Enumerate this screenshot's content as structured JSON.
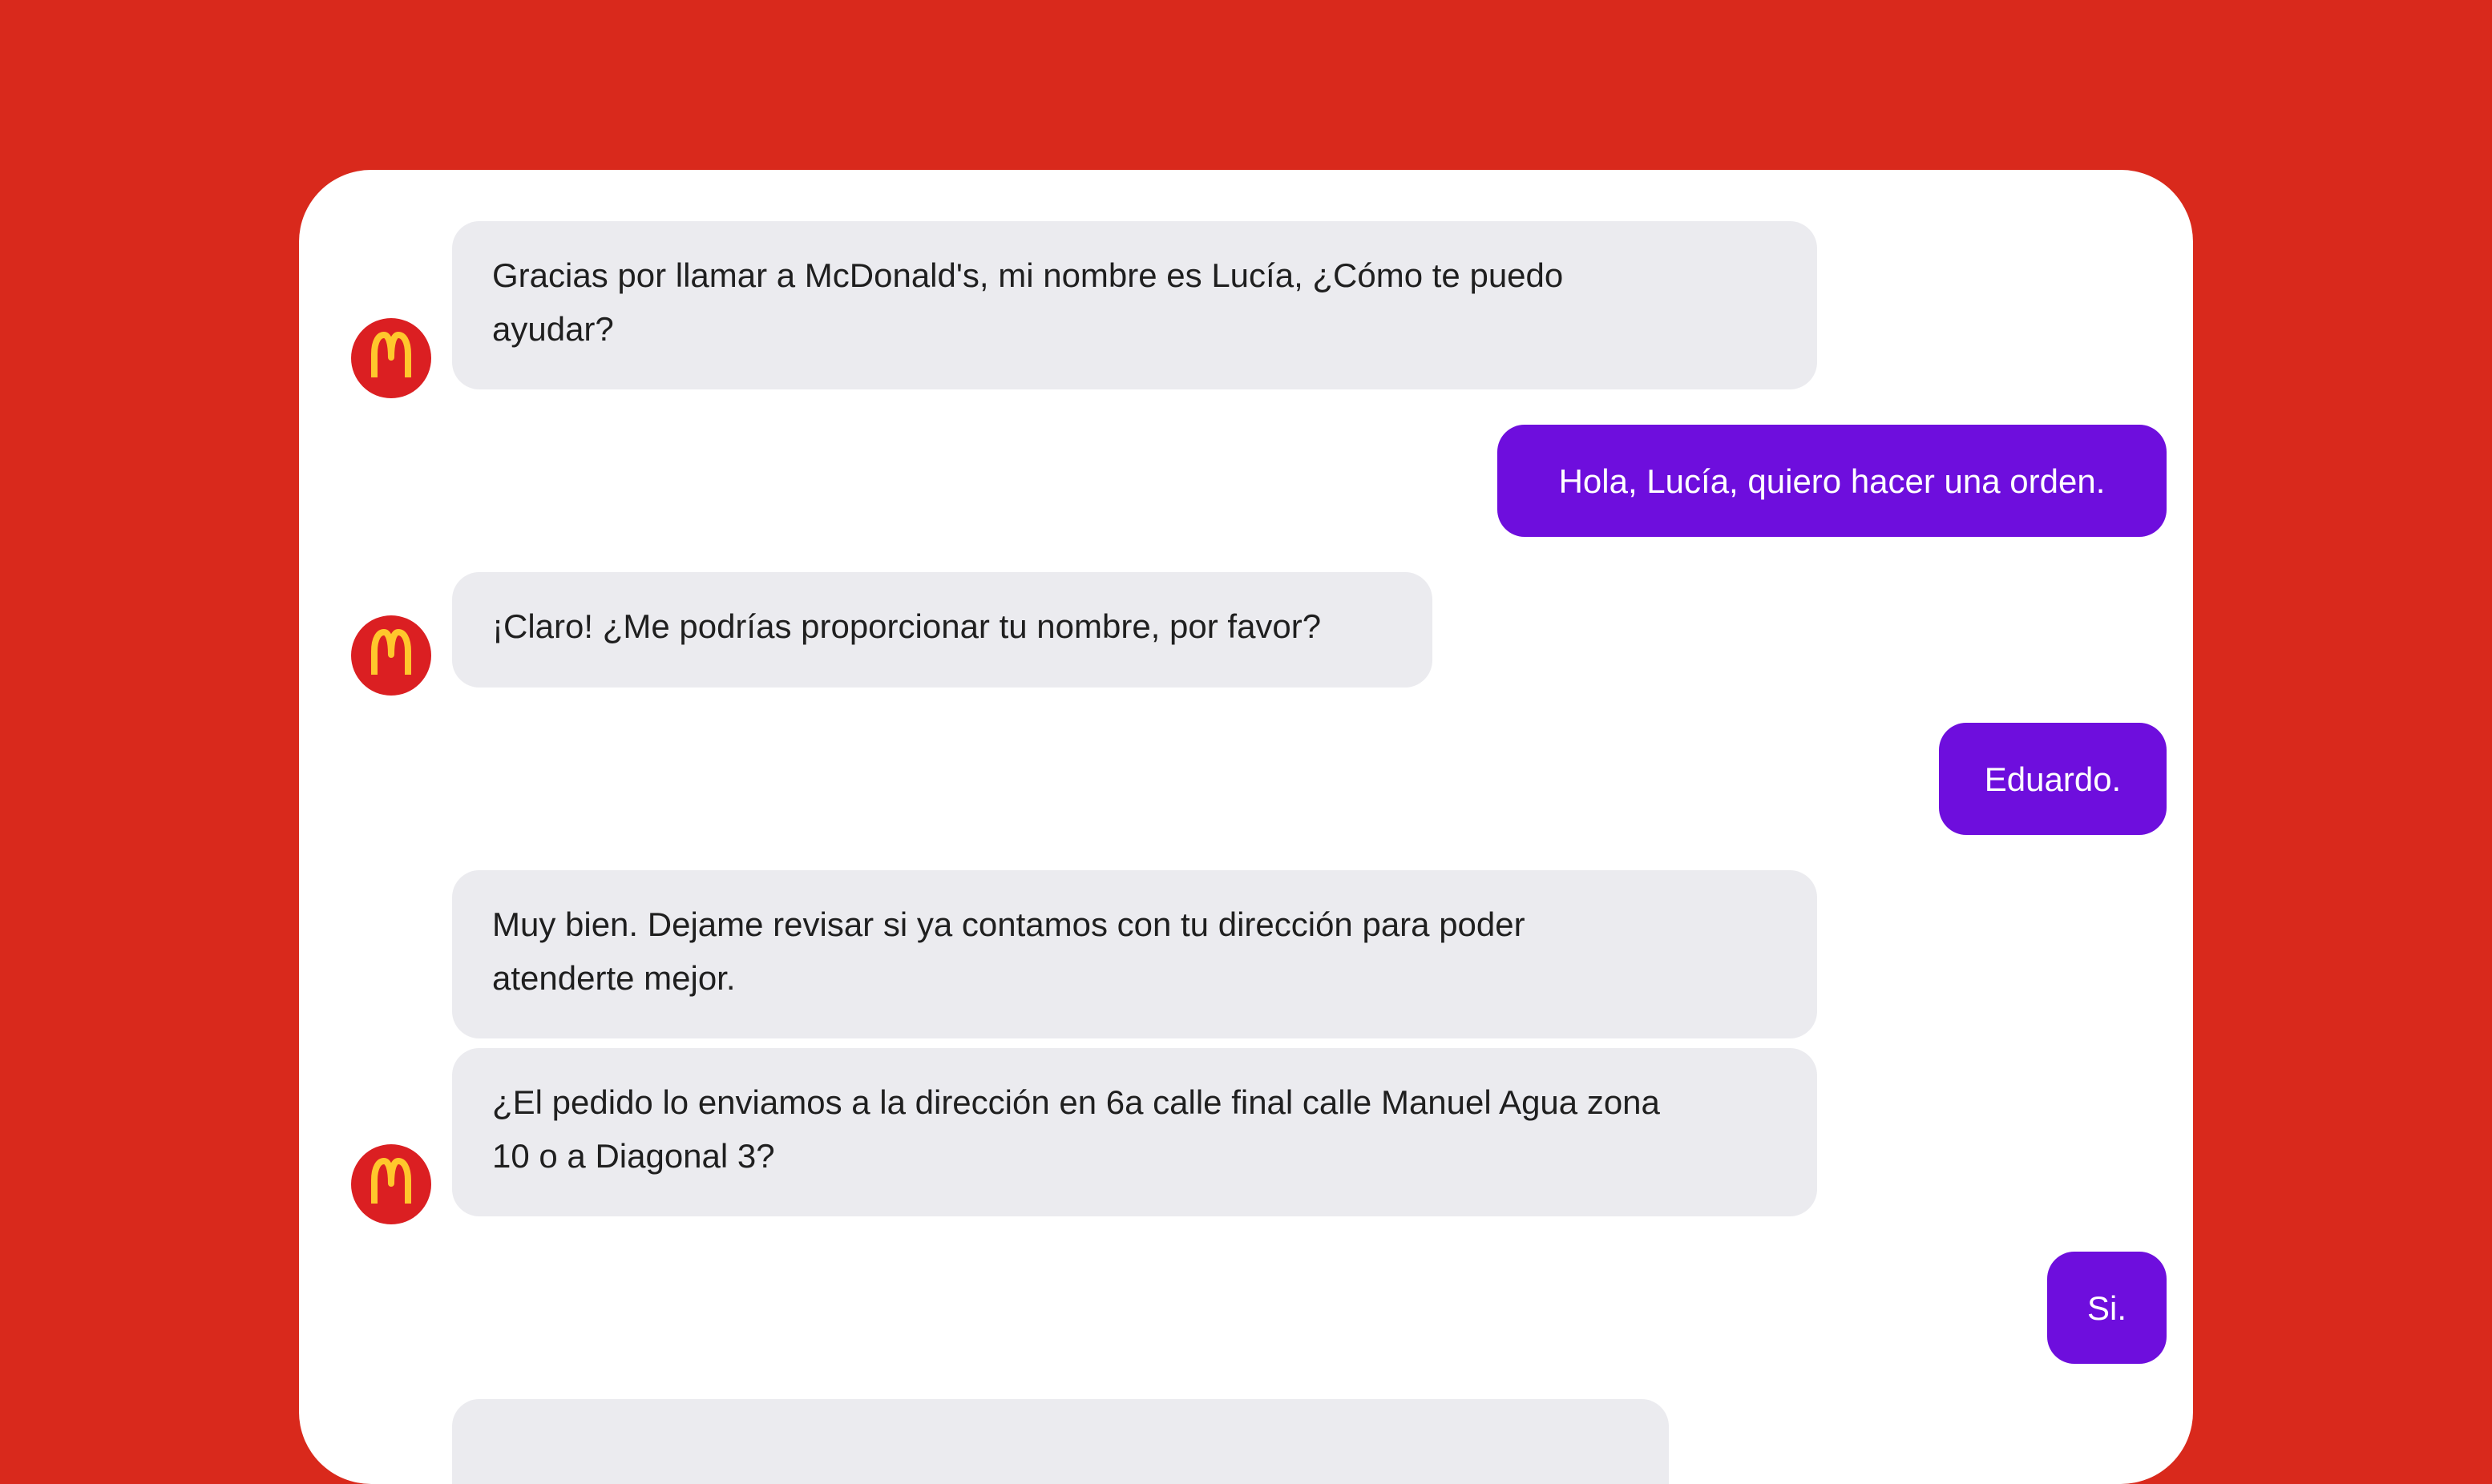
{
  "brand": {
    "background_color": "#D9291C",
    "card_color": "#FFFFFF",
    "bot_bubble_color": "#EBEBEF",
    "user_bubble_color": "#6E0EDD",
    "avatar_color": "#DB1F22",
    "logo_color": "#FFC72C",
    "avatar_icon": "mcdonalds-arches-icon"
  },
  "messages": [
    {
      "sender": "bot",
      "lines": [
        "Gracias por llamar a McDonald's, mi nombre es Lucía, ¿Cómo te puedo",
        "ayudar?"
      ]
    },
    {
      "sender": "user",
      "lines": [
        "Hola, Lucía, quiero hacer una orden."
      ]
    },
    {
      "sender": "bot",
      "lines": [
        "¡Claro! ¿Me podrías proporcionar tu nombre, por favor?"
      ]
    },
    {
      "sender": "user",
      "lines": [
        "Eduardo."
      ]
    },
    {
      "sender": "bot",
      "lines": [
        "Muy bien. Dejame revisar si ya contamos con tu dirección para poder",
        "atenderte mejor."
      ]
    },
    {
      "sender": "bot",
      "lines": [
        "¿El pedido lo enviamos a la dirección en 6a calle final calle Manuel Agua zona",
        "10 o a Diagonal 3?"
      ]
    },
    {
      "sender": "user",
      "lines": [
        "Si."
      ]
    },
    {
      "sender": "bot",
      "lines": [
        ""
      ]
    }
  ]
}
